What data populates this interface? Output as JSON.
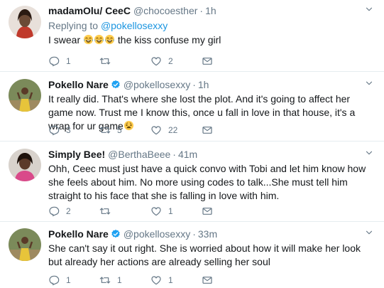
{
  "tweets": [
    {
      "name": "madamOlu/ CeeC",
      "handle": "@chocoesther",
      "separator": "·",
      "time": "1h",
      "replying_prefix": "Replying to",
      "replying_handle": "@pokellosexxy",
      "text_before": "I swear",
      "text_after": "the kiss confuse my girl",
      "reply_count": "1",
      "retweet_count": "",
      "like_count": "2",
      "verified": false
    },
    {
      "name": "Pokello Nare",
      "handle": "@pokellosexxy",
      "separator": "·",
      "time": "1h",
      "text": "It really did. That's where she lost the plot. And it's going to affect her game now. Trust me I know this, once u fall in love in that house, it's a wrap for ur game",
      "reply_count": "3",
      "retweet_count": "5",
      "like_count": "22",
      "verified": true
    },
    {
      "name": "Simply Bee!",
      "handle": "@BerthaBeee",
      "separator": "·",
      "time": "41m",
      "text": "Ohh, Ceec must just have a quick convo with Tobi and let him know how she feels about him. No more using codes to talk...She must tell him straight to his face that she is falling in love with him.",
      "reply_count": "2",
      "retweet_count": "",
      "like_count": "1",
      "verified": false
    },
    {
      "name": "Pokello Nare",
      "handle": "@pokellosexxy",
      "separator": "·",
      "time": "33m",
      "text": "She can't say it out right. She is worried about how it will make her look but already her actions are already selling her soul",
      "reply_count": "1",
      "retweet_count": "1",
      "like_count": "1",
      "verified": true
    }
  ],
  "icons": {
    "reply": "reply-icon",
    "retweet": "retweet-icon",
    "like": "heart-icon",
    "dm": "envelope-icon",
    "verified": "verified-badge-icon",
    "caret": "chevron-down-icon",
    "emoji_laugh": "tears-of-joy-emoji",
    "emoji_weary": "weary-face-emoji"
  },
  "colors": {
    "link": "#1b95e0",
    "meta": "#657786",
    "text": "#14171a",
    "divider": "#e6ecf0",
    "verified": "#1da1f2"
  }
}
